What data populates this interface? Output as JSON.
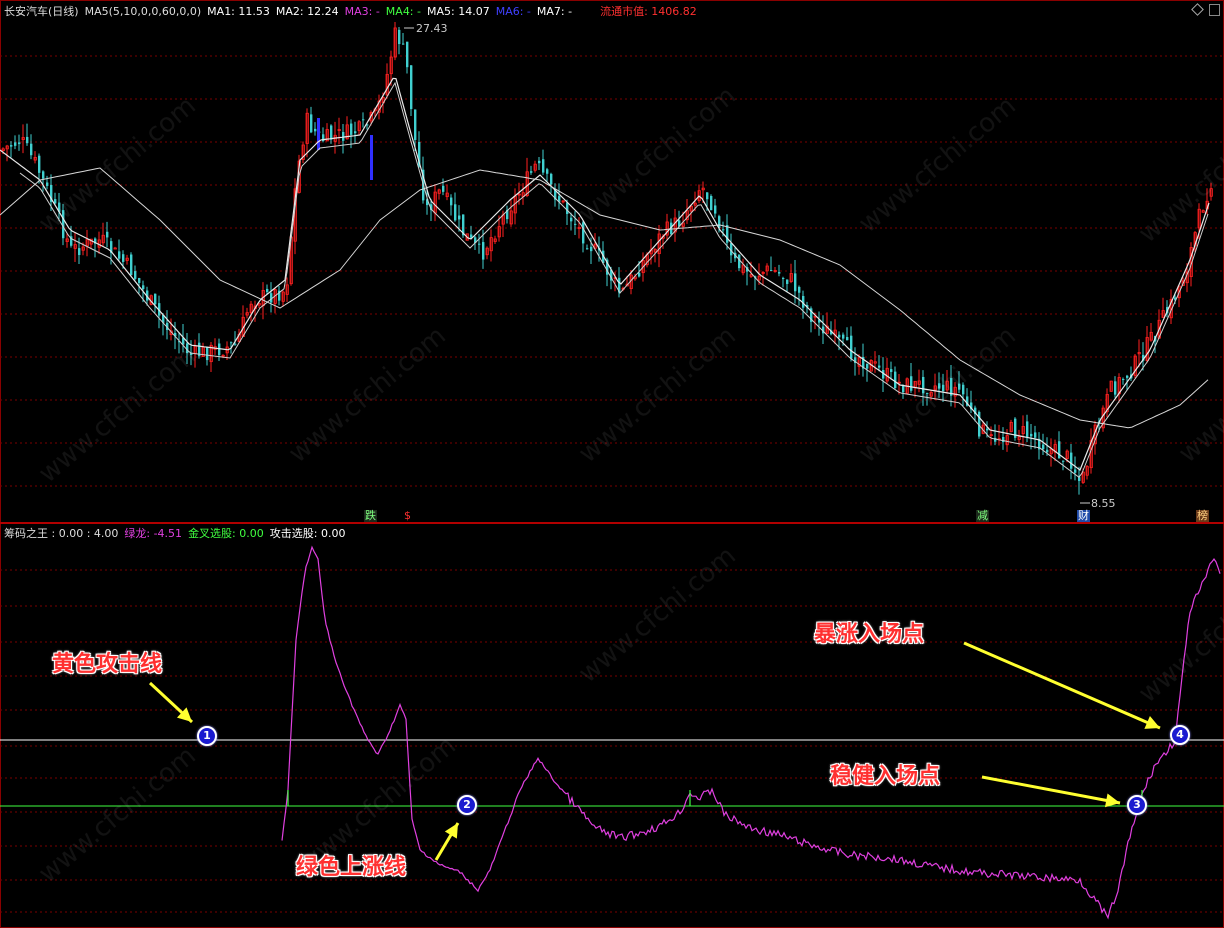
{
  "top_panel": {
    "title": "长安汽车(日线)",
    "ma_params": "MA5(5,10,0,0,60,0,0)",
    "ma1": "MA1: 11.53",
    "ma2": "MA2: 12.24",
    "ma3": "MA3: -",
    "ma4": "MA4: -",
    "ma5": "MA5: 14.07",
    "ma6": "MA6: -",
    "ma7": "MA7: -",
    "market_cap": "流通市值: 1406.82",
    "high_label": "27.43",
    "low_label": "8.55",
    "events": [
      {
        "text": "跌",
        "color": "#7fff7f",
        "bg": "#1c2a1c"
      },
      {
        "text": "$",
        "color": "#ff3030",
        "bg": "transparent"
      },
      {
        "text": "减",
        "color": "#7fff7f",
        "bg": "#1c2a1c"
      },
      {
        "text": "财",
        "color": "#ffffff",
        "bg": "#1f4aa8"
      },
      {
        "text": "榜",
        "color": "#ffd080",
        "bg": "#6a3a1a"
      }
    ]
  },
  "bottom_panel": {
    "title": "筹码之王",
    "values": ": 0.00 : 4.00",
    "green_dragon": "绿龙: -4.51",
    "golden_cross": "金叉选股: 0.00",
    "attack": "攻击选股: 0.00"
  },
  "annotations": {
    "yellow_line": "黄色攻击线",
    "green_line": "绿色上涨线",
    "surge_entry": "暴涨入场点",
    "steady_entry": "稳健入场点"
  },
  "points": [
    "1",
    "2",
    "3",
    "4"
  ],
  "watermark": "www.cfchi.com",
  "colors": {
    "up": "#ff2020",
    "down": "#40d0d0",
    "ma_white": "#e8e8e8",
    "grid": "#7a0000",
    "indicator": "#e040e0",
    "yellow_line": "#ffffff",
    "green_line": "#40ff40",
    "arrow": "#ffff30"
  },
  "chart_data": {
    "type": "candlestick",
    "series": [
      {
        "name": "MA1"
      },
      {
        "name": "MA2"
      },
      {
        "name": "MA5"
      },
      {
        "name": "筹码之王"
      }
    ]
  }
}
